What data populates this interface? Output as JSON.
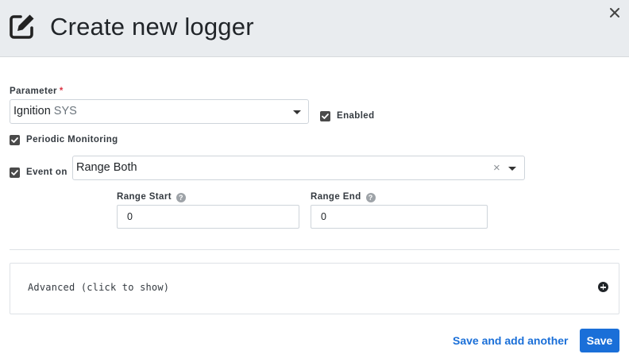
{
  "dialog": {
    "title": "Create new logger",
    "icons": {
      "header": "edit-square-icon",
      "close": "close-icon"
    }
  },
  "form": {
    "parameter": {
      "label": "Parameter",
      "required_mark": "*",
      "value_name": "Ignition",
      "value_unit": "SYS"
    },
    "enabled": {
      "label": "Enabled",
      "checked": true
    },
    "periodic_monitoring": {
      "label": "Periodic Monitoring",
      "checked": true
    },
    "event_on": {
      "label": "Event on",
      "checked": true,
      "value": "Range Both",
      "clear_glyph": "×"
    },
    "range_start": {
      "label": "Range Start",
      "help": "?",
      "value": "0"
    },
    "range_end": {
      "label": "Range End",
      "help": "?",
      "value": "0"
    },
    "advanced": {
      "label": "Advanced (click to show)",
      "icon": "plus-circle-icon"
    }
  },
  "footer": {
    "save_and_add_label": "Save and add another",
    "save_label": "Save"
  },
  "colors": {
    "header_bg": "#e9ecef",
    "primary": "#1a6fd8",
    "required": "#dc3545",
    "checkbox": "#4a4a4a"
  }
}
